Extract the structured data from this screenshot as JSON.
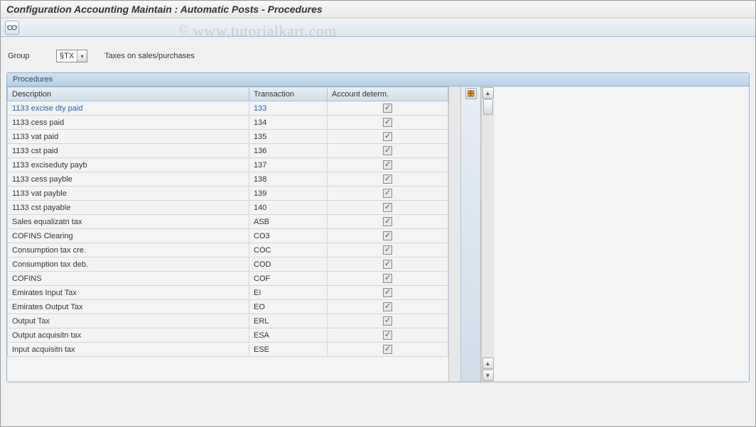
{
  "title": "Configuration Accounting Maintain : Automatic Posts - Procedures",
  "watermark": "www.tutorialkart.com",
  "toolbar": {
    "glasses_title": "Display"
  },
  "group": {
    "label": "Group",
    "code": "§TX",
    "description": "Taxes on sales/purchases"
  },
  "panel": {
    "title": "Procedures",
    "columns": {
      "description": "Description",
      "transaction": "Transaction",
      "account_determ": "Account determ."
    },
    "config_btn_title": "Configuration",
    "rows": [
      {
        "description": "1133 excise dty paid",
        "transaction": "133",
        "account_determ": true,
        "selected": true
      },
      {
        "description": "1133 cess paid",
        "transaction": "134",
        "account_determ": true
      },
      {
        "description": "1133 vat paid",
        "transaction": "135",
        "account_determ": true
      },
      {
        "description": "1133 cst paid",
        "transaction": "136",
        "account_determ": true
      },
      {
        "description": "1133 exciseduty payb",
        "transaction": "137",
        "account_determ": true
      },
      {
        "description": "1133 cess payble",
        "transaction": "138",
        "account_determ": true
      },
      {
        "description": "1133 vat payble",
        "transaction": "139",
        "account_determ": true
      },
      {
        "description": "1133 cst payable",
        "transaction": "140",
        "account_determ": true
      },
      {
        "description": "Sales equalizatn tax",
        "transaction": "ASB",
        "account_determ": true
      },
      {
        "description": "COFINS Clearing",
        "transaction": "CO3",
        "account_determ": true
      },
      {
        "description": "Consumption tax cre.",
        "transaction": "COC",
        "account_determ": true
      },
      {
        "description": "Consumption tax deb.",
        "transaction": "COD",
        "account_determ": true
      },
      {
        "description": "COFINS",
        "transaction": "COF",
        "account_determ": true
      },
      {
        "description": "Emirates Input Tax",
        "transaction": "EI",
        "account_determ": true
      },
      {
        "description": "Emirates Output Tax",
        "transaction": "EO",
        "account_determ": true
      },
      {
        "description": "Output Tax",
        "transaction": "ERL",
        "account_determ": true
      },
      {
        "description": "Output acquisitn tax",
        "transaction": "ESA",
        "account_determ": true
      },
      {
        "description": "Input acquisitn tax",
        "transaction": "ESE",
        "account_determ": true
      }
    ]
  }
}
